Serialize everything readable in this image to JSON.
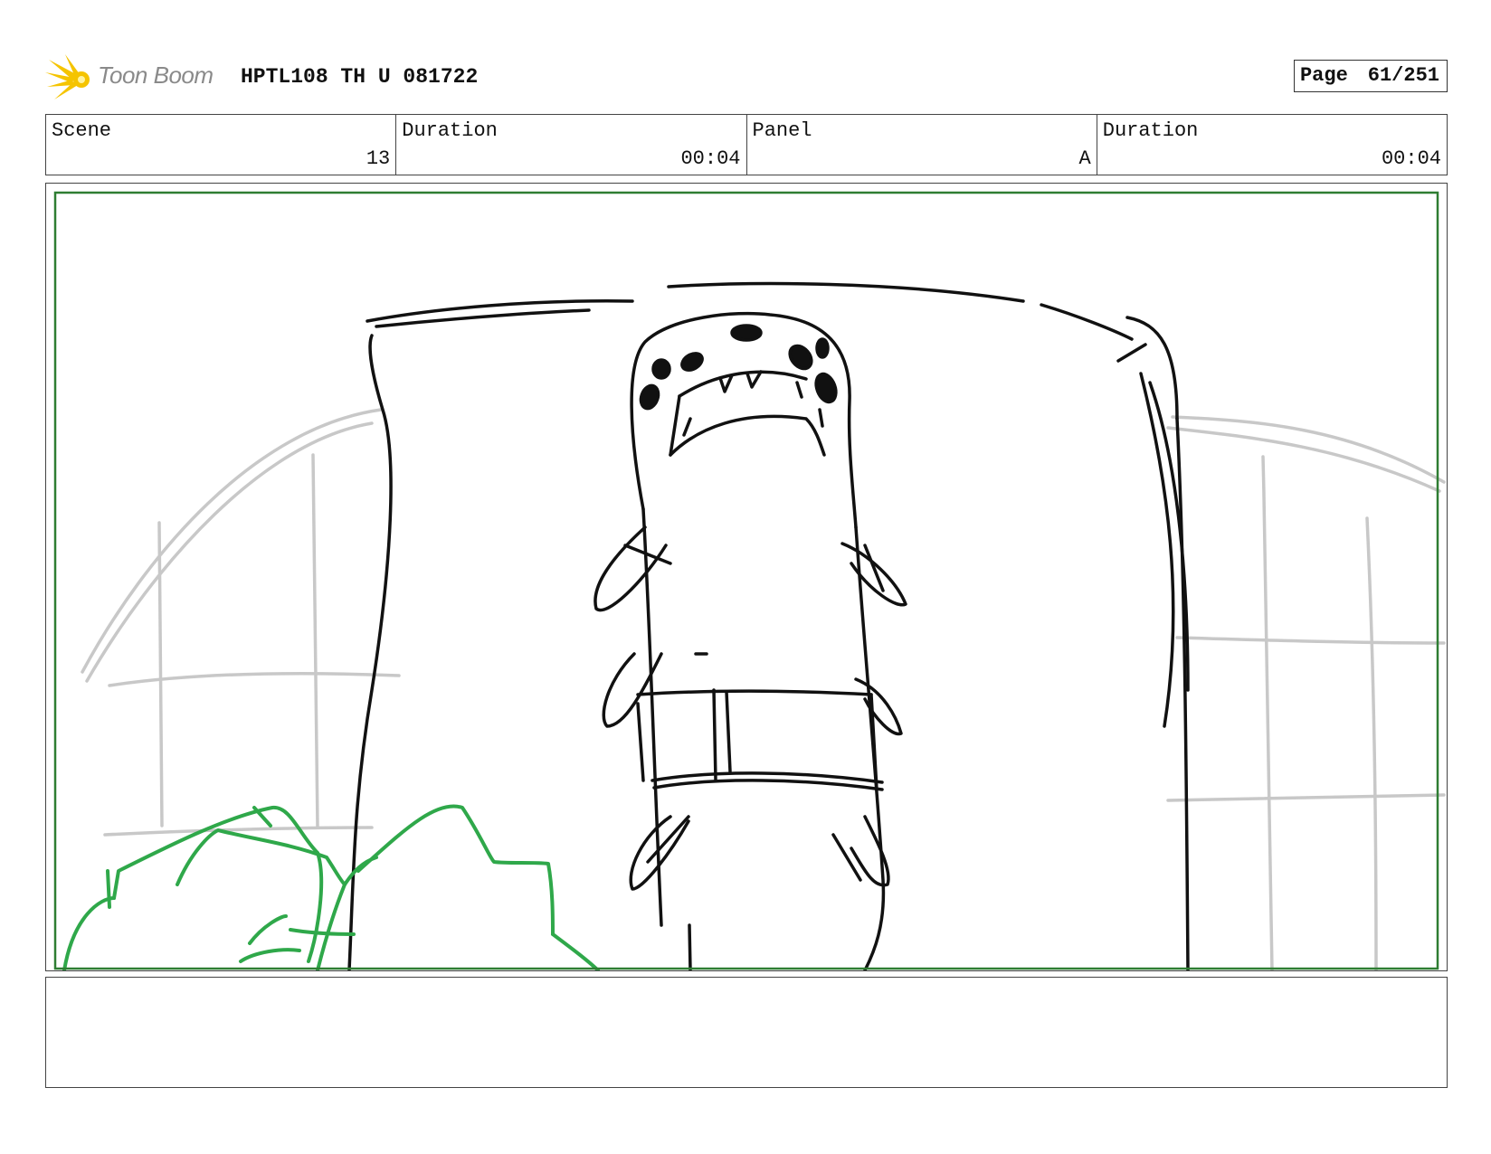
{
  "header": {
    "logo_text": "Toon Boom",
    "document_title": "HPTL108 TH U 081722",
    "page_label": "Page",
    "page_number": "61/251"
  },
  "info": {
    "scene_label": "Scene",
    "scene_value": "13",
    "scene_duration_label": "Duration",
    "scene_duration_value": "00:04",
    "panel_label": "Panel",
    "panel_value": "A",
    "panel_duration_label": "Duration",
    "panel_duration_value": "00:04"
  },
  "notes": {
    "text": ""
  },
  "colors": {
    "safe_frame": "#2e7d32",
    "bushes": "#2fa84a",
    "background_lines": "#c8c8c8",
    "ink": "#111111",
    "logo_yellow": "#f5c400"
  }
}
